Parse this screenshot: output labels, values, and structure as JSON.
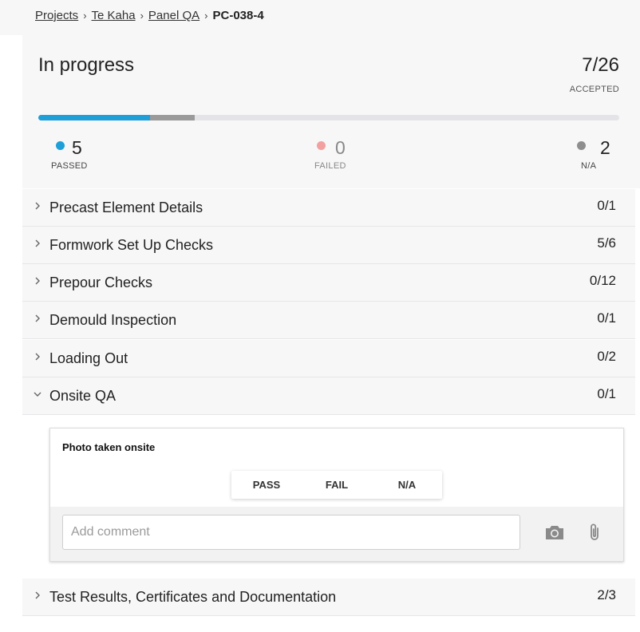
{
  "breadcrumb": {
    "items": [
      "Projects",
      "Te Kaha",
      "Panel QA"
    ],
    "current": "PC-038-4",
    "separator": "›"
  },
  "summary": {
    "status": "In progress",
    "accepted_count": "7/26",
    "accepted_label": "ACCEPTED",
    "progress": {
      "passed_fraction": 0.192,
      "na_fraction": 0.077
    },
    "passed": {
      "value": "5",
      "label": "PASSED",
      "color": "#1e9fd8"
    },
    "failed": {
      "value": "0",
      "label": "FAILED",
      "color": "#f2a0a0"
    },
    "na": {
      "value": "2",
      "label": "N/A",
      "color": "#8e8e8e"
    }
  },
  "sections": [
    {
      "title": "Precast Element Details",
      "count": "0/1",
      "expanded": false
    },
    {
      "title": "Formwork Set Up Checks",
      "count": "5/6",
      "expanded": false
    },
    {
      "title": "Prepour Checks",
      "count": "0/12",
      "expanded": false
    },
    {
      "title": "Demould Inspection",
      "count": "0/1",
      "expanded": false
    },
    {
      "title": "Loading Out",
      "count": "0/2",
      "expanded": false
    },
    {
      "title": "Onsite QA",
      "count": "0/1",
      "expanded": true
    },
    {
      "title": "Test Results, Certificates and Documentation",
      "count": "2/3",
      "expanded": false
    }
  ],
  "check_item": {
    "title": "Photo taken onsite",
    "options": [
      "PASS",
      "FAIL",
      "N/A"
    ],
    "comment_placeholder": "Add comment",
    "camera_icon": "camera-icon",
    "attach_icon": "paperclip-icon"
  }
}
